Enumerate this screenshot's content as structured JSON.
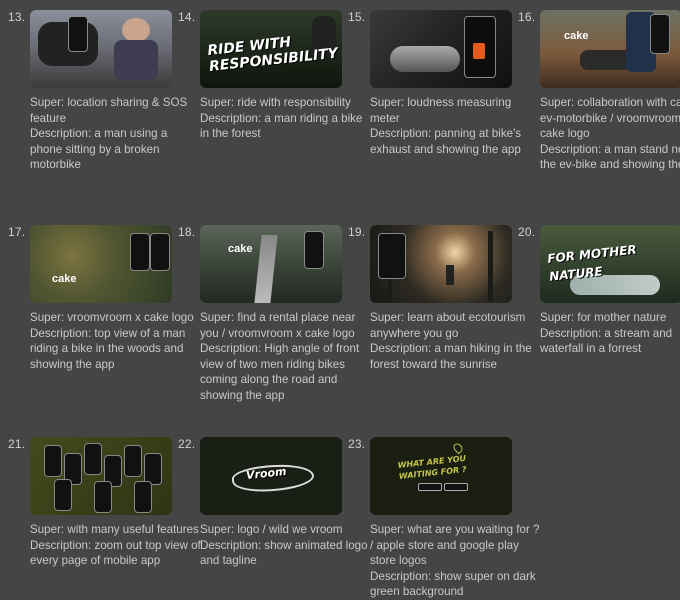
{
  "scenes": [
    {
      "num": "13.",
      "super": "Super: location sharing & SOS feature",
      "desc": "Description: a man using a phone sitting by a broken motorbike"
    },
    {
      "num": "14.",
      "super": "Super: ride with responsibility",
      "desc": "Description: a man riding a bike in the forest",
      "overlay": "RIDE WITH RESPONSIBILITY"
    },
    {
      "num": "15.",
      "super": "Super: loudness measuring meter",
      "desc": "Description: panning at bike's exhaust and showing the app"
    },
    {
      "num": "16.",
      "super": "Super: collaboration with cake ev-motorbike / vroomvroom x cake logo",
      "desc": "Description: a man stand next to the ev-bike and showing the app",
      "overlay": "cake"
    },
    {
      "num": "17.",
      "super": "Super: vroomvroom x cake logo",
      "desc": "Description: top view of a man riding a bike in the woods and showing the app",
      "overlay": "cake"
    },
    {
      "num": "18.",
      "super": "Super: find a rental place near you / vroomvroom x cake logo",
      "desc": "Description: High angle of front view of two men riding bikes coming along the road and showing the app",
      "overlay": "cake"
    },
    {
      "num": "19.",
      "super": "Super: learn about ecotourism anywhere you go",
      "desc": "Description: a man hiking in the forest toward the sunrise"
    },
    {
      "num": "20.",
      "super": "Super: for mother nature",
      "desc": "Description: a stream and waterfall in a forrest",
      "overlay": "FOR MOTHER NATURE"
    },
    {
      "num": "21.",
      "super": "Super: with many useful features",
      "desc": "Description: zoom out top view of every page of mobile app"
    },
    {
      "num": "22.",
      "super": "Super: logo / wild we vroom",
      "desc": "Description: show animated logo and tagline",
      "overlay": "Vroom"
    },
    {
      "num": "23.",
      "super": "Super: what are you waiting for ? / apple store and google play store logos",
      "desc": "Description: show super on dark green background",
      "overlay": "WHAT ARE YOU WAITING FOR ?"
    }
  ]
}
